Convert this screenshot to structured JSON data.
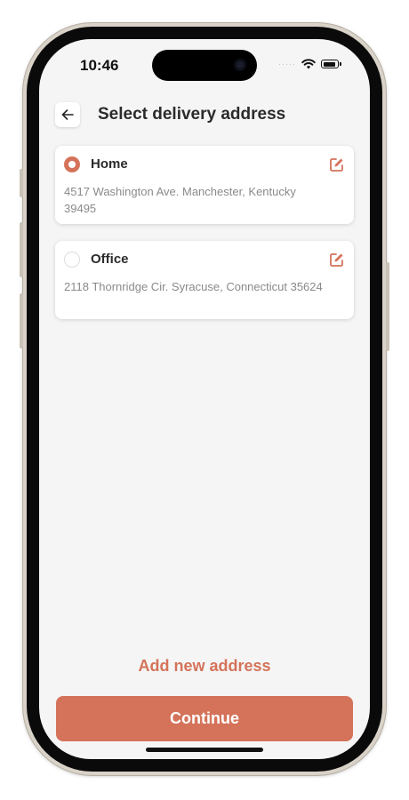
{
  "status_bar": {
    "time": "10:46",
    "signal": "·····"
  },
  "header": {
    "title": "Select delivery address"
  },
  "addresses": [
    {
      "label": "Home",
      "address": "4517 Washington Ave. Manchester, Kentucky 39495",
      "selected": true
    },
    {
      "label": "Office",
      "address": "2118 Thornridge Cir. Syracuse, Connecticut 35624",
      "selected": false
    }
  ],
  "actions": {
    "add_new": "Add new address",
    "continue": "Continue"
  },
  "colors": {
    "accent": "#d4735a",
    "background": "#f5f5f5"
  }
}
